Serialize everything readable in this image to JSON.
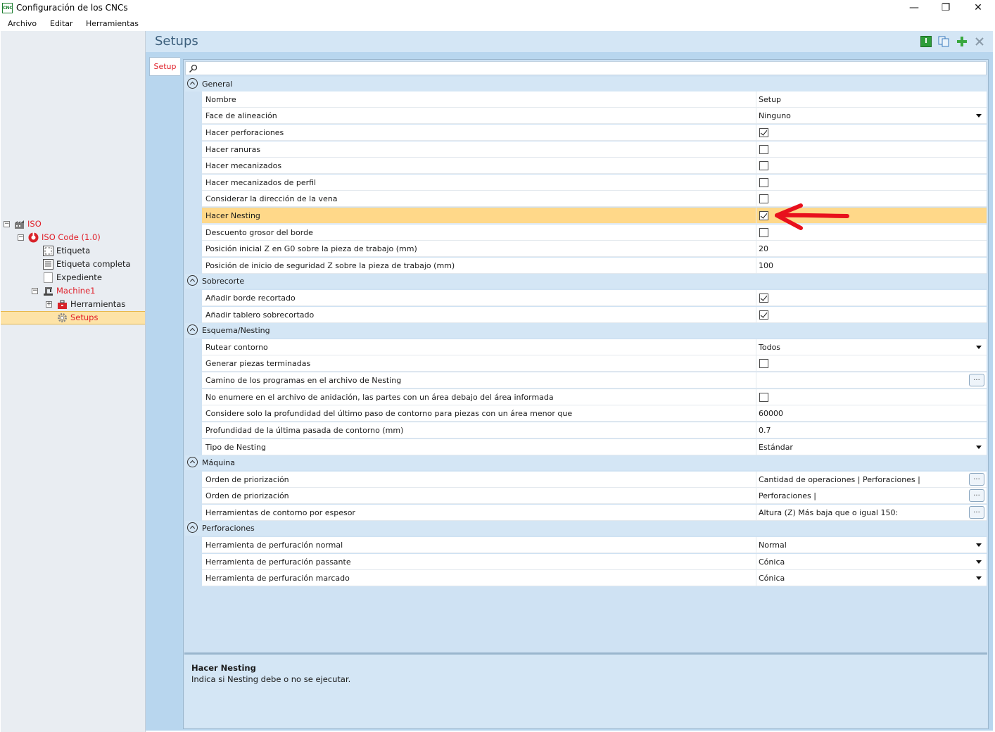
{
  "window": {
    "title": "Configuración de los CNCs",
    "app_icon_text": "CNC",
    "minimize": "—",
    "maximize": "❐",
    "close": "✕"
  },
  "menu": [
    "Archivo",
    "Editar",
    "Herramientas"
  ],
  "tree": {
    "iso": "ISO",
    "iso_code": "ISO Code (1.0)",
    "etiqueta": "Etiqueta",
    "etiqueta_completa": "Etiqueta completa",
    "expediente": "Expediente",
    "machine": "Machine1",
    "herramientas": "Herramientas",
    "setups": "Setups"
  },
  "header": {
    "title": "Setups"
  },
  "tab": {
    "label": "Setup"
  },
  "search": {
    "placeholder": ""
  },
  "categories": {
    "general": "General",
    "sobrecorte": "Sobrecorte",
    "esquema": "Esquema/Nesting",
    "maquina": "Máquina",
    "perforaciones": "Perforaciones"
  },
  "props": {
    "nombre": {
      "name": "Nombre",
      "value": "Setup"
    },
    "face": {
      "name": "Face de alineación",
      "value": "Ninguno"
    },
    "perforaciones": {
      "name": "Hacer perforaciones",
      "checked": true
    },
    "ranuras": {
      "name": "Hacer ranuras",
      "checked": false
    },
    "mecanizados": {
      "name": "Hacer mecanizados",
      "checked": false
    },
    "perfil": {
      "name": "Hacer mecanizados de perfil",
      "checked": false
    },
    "vena": {
      "name": "Considerar la dirección de la vena",
      "checked": false
    },
    "nesting": {
      "name": "Hacer Nesting",
      "checked": true
    },
    "descuento": {
      "name": "Descuento grosor del borde",
      "checked": false
    },
    "posz": {
      "name": "Posición inicial Z en G0 sobre la pieza de trabajo (mm)",
      "value": "20"
    },
    "posseg": {
      "name": "Posición de inicio de seguridad Z sobre la pieza de trabajo (mm)",
      "value": "100"
    },
    "borde": {
      "name": "Añadir borde recortado",
      "checked": true
    },
    "tablero": {
      "name": "Añadir tablero sobrecortado",
      "checked": true
    },
    "rutear": {
      "name": "Rutear contorno",
      "value": "Todos"
    },
    "generar": {
      "name": "Generar piezas terminadas",
      "checked": false
    },
    "camino": {
      "name": "Camino de los programas en el archivo de Nesting",
      "value": ""
    },
    "noenumere": {
      "name": "No enumere en el archivo de anidación, las partes con un área debajo del área informada",
      "checked": false
    },
    "considere": {
      "name": "Considere solo la profundidad del último paso de contorno para piezas con un área menor que",
      "value": "60000"
    },
    "profundidad": {
      "name": "Profundidad de la última pasada de contorno (mm)",
      "value": "0.7"
    },
    "tipo": {
      "name": "Tipo de Nesting",
      "value": "Estándar"
    },
    "orden1": {
      "name": "Orden de priorización",
      "value": "Cantidad de operaciones | Perforaciones |"
    },
    "orden2": {
      "name": "Orden de priorización",
      "value": "Perforaciones |"
    },
    "contorno": {
      "name": "Herramientas de contorno por espesor",
      "value": "Altura (Z) Más baja que o igual 150:"
    },
    "normal": {
      "name": "Herramienta de perfuración normal",
      "value": "Normal"
    },
    "passante": {
      "name": "Herramienta de perfuración passante",
      "value": "Cónica"
    },
    "marcado": {
      "name": "Herramienta de perfuración marcado",
      "value": "Cónica"
    }
  },
  "ellipsis": "...",
  "description": {
    "title": "Hacer Nesting",
    "text": "Indica si Nesting debe o no se ejecutar."
  },
  "colors": {
    "accent_red": "#e0202a",
    "highlight": "#ffd889",
    "panel_blue": "#b8d6ee"
  }
}
